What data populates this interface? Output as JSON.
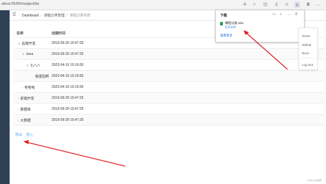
{
  "browser": {
    "url": "alhost:9528/#/subject/list"
  },
  "breadcrumb": {
    "home": "Dashboard",
    "section": "课程分类管理",
    "current": "课程分类列表"
  },
  "table": {
    "headers": [
      "名称",
      "创建时间"
    ],
    "rows": [
      {
        "name": "后端开发",
        "date": "2019-09-29 15:47:25",
        "caret": "∨"
      },
      {
        "name": "Java",
        "date": "2019-09-29 15:47:25",
        "caret": "∨"
      },
      {
        "name": "七八八",
        "date": "2023-04-19 15:16:50",
        "caret": "∨"
      },
      {
        "name": "我很招啊",
        "date": "2023-04-19 15:16:50",
        "caret": ""
      },
      {
        "name": "哇哈哈",
        "date": "2023-04-19 15:16:50",
        "caret": "›"
      },
      {
        "name": "前端开发",
        "date": "2019-09-29 15:47:25",
        "caret": "›"
      },
      {
        "name": "数据库",
        "date": "2019-09-29 15:47:25",
        "caret": "›"
      },
      {
        "name": "大数据",
        "date": "2019-09-29 15:47:25",
        "caret": "›"
      }
    ]
  },
  "actions": {
    "export": "导出",
    "import": "导入"
  },
  "downloads": {
    "title": "下载",
    "file_name": "课程分类.xlsx",
    "open_file": "打开文件",
    "see_more": "查看更多"
  },
  "user_menu": {
    "home": "Home",
    "github": "Github",
    "docs": "Docs",
    "logout": "Log Out"
  },
  "watermark": "CSDN @枫林"
}
